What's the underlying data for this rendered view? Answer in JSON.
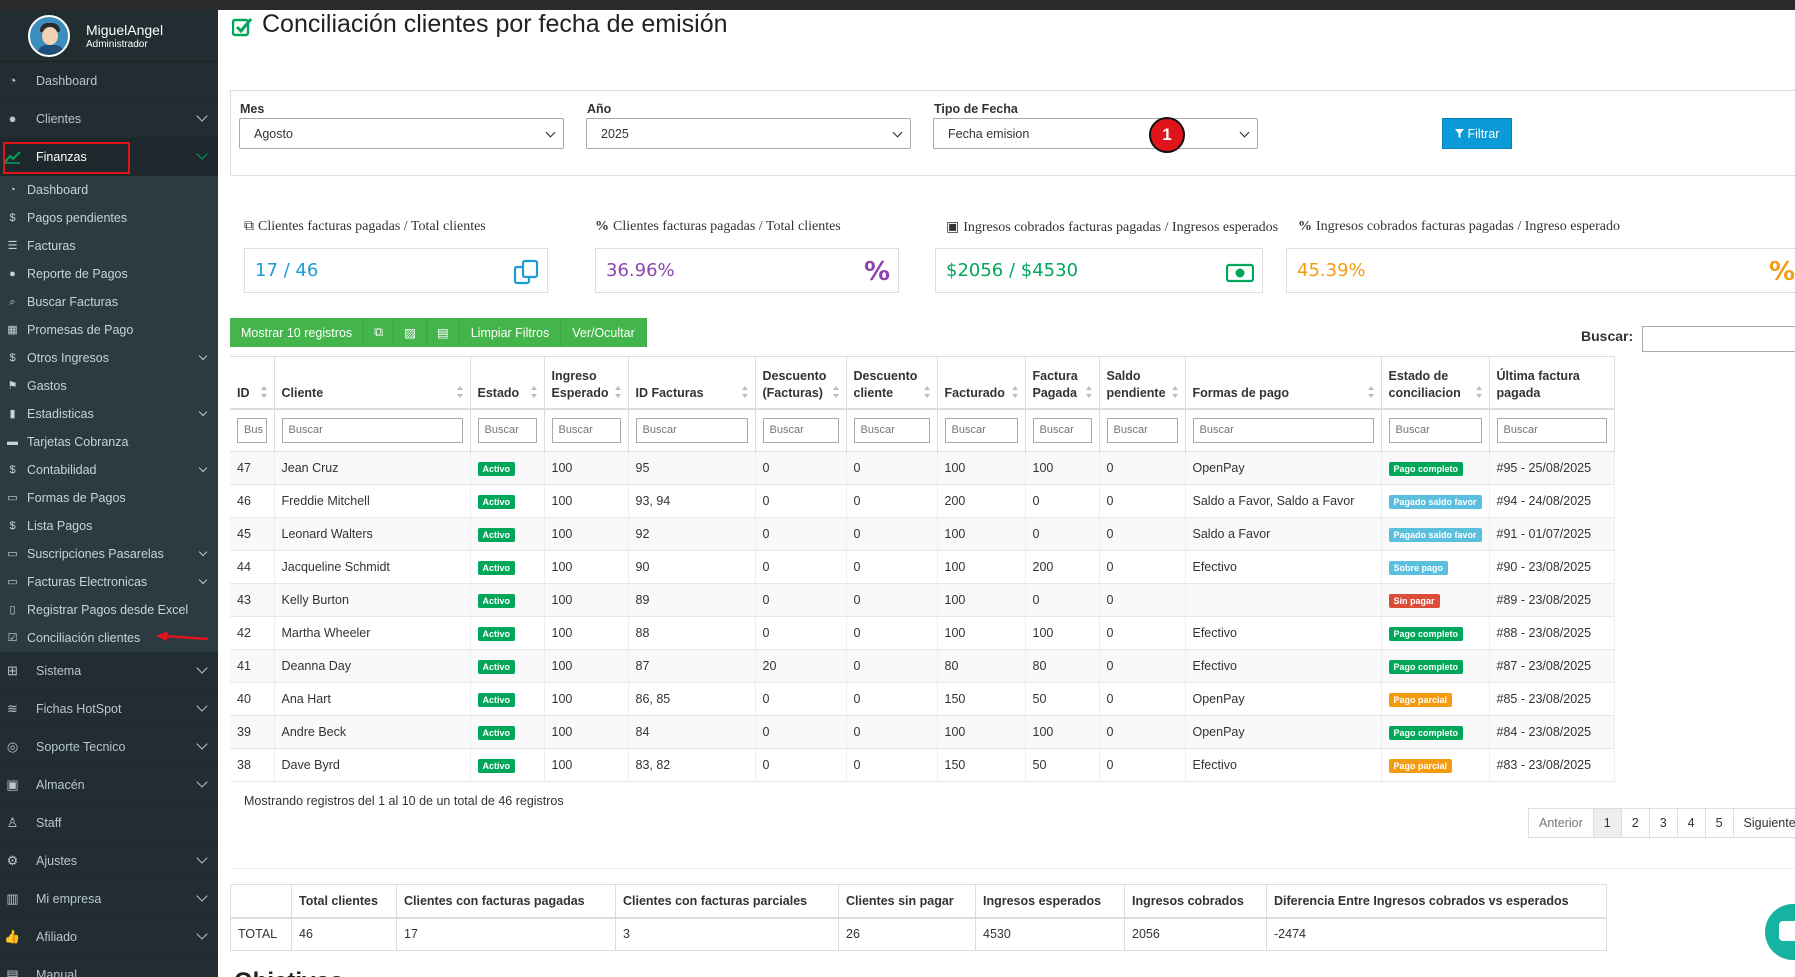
{
  "user": {
    "name": "MiguelAngel",
    "role": "Administrador"
  },
  "sidebar": {
    "top_items": [
      {
        "label": "Dashboard",
        "icon": "dashboard-icon",
        "chevron": false
      },
      {
        "label": "Clientes",
        "icon": "users-icon",
        "chevron": true
      },
      {
        "label": "Finanzas",
        "icon": "chart-line-icon",
        "chevron": true,
        "active": true
      }
    ],
    "finanzas_sub": [
      {
        "label": "Dashboard",
        "icon": "dashboard-icon",
        "chevron": false
      },
      {
        "label": "Pagos pendientes",
        "icon": "dollar-icon",
        "chevron": false
      },
      {
        "label": "Facturas",
        "icon": "list-icon",
        "chevron": false
      },
      {
        "label": "Reporte de Pagos",
        "icon": "info-circle-icon",
        "chevron": false
      },
      {
        "label": "Buscar Facturas",
        "icon": "search-icon",
        "chevron": false
      },
      {
        "label": "Promesas de Pago",
        "icon": "calendar-icon",
        "chevron": false
      },
      {
        "label": "Otros Ingresos",
        "icon": "dollar-icon",
        "chevron": true
      },
      {
        "label": "Gastos",
        "icon": "flag-icon",
        "chevron": false
      },
      {
        "label": "Estadisticas",
        "icon": "bar-chart-icon",
        "chevron": true
      },
      {
        "label": "Tarjetas Cobranza",
        "icon": "card-icon",
        "chevron": false
      },
      {
        "label": "Contabilidad",
        "icon": "dollar-icon",
        "chevron": true
      },
      {
        "label": "Formas de Pagos",
        "icon": "card-icon",
        "chevron": false
      },
      {
        "label": "Lista Pagos",
        "icon": "dollar-icon",
        "chevron": false
      },
      {
        "label": "Suscripciones Pasarelas",
        "icon": "card-icon",
        "chevron": true
      },
      {
        "label": "Facturas Electronicas",
        "icon": "card-icon",
        "chevron": true
      },
      {
        "label": "Registrar Pagos desde Excel",
        "icon": "file-icon",
        "chevron": false
      },
      {
        "label": "Conciliación clientes",
        "icon": "check-square-icon",
        "chevron": false
      }
    ],
    "bottom_items": [
      {
        "label": "Sistema",
        "icon": "sitemap-icon",
        "chevron": true
      },
      {
        "label": "Fichas HotSpot",
        "icon": "wifi-icon",
        "chevron": true
      },
      {
        "label": "Soporte Tecnico",
        "icon": "lifebuoy-icon",
        "chevron": true
      },
      {
        "label": "Almacén",
        "icon": "box-icon",
        "chevron": true
      },
      {
        "label": "Staff",
        "icon": "person-icon",
        "chevron": false
      },
      {
        "label": "Ajustes",
        "icon": "gear-icon",
        "chevron": true
      },
      {
        "label": "Mi empresa",
        "icon": "building-icon",
        "chevron": true
      },
      {
        "label": "Afiliado",
        "icon": "thumbs-up-icon",
        "chevron": true
      },
      {
        "label": "Manual",
        "icon": "book-icon",
        "chevron": false
      }
    ]
  },
  "page": {
    "title": "Conciliación clientes por fecha de emisión"
  },
  "filters": {
    "mes_label": "Mes",
    "mes_value": "Agosto",
    "anio_label": "Año",
    "anio_value": "2025",
    "tipo_label": "Tipo de Fecha",
    "tipo_value": "Fecha emision",
    "filtrar_label": "Filtrar",
    "annotation_number": "1"
  },
  "stats": [
    {
      "label": "Clientes facturas pagadas / Total clientes",
      "value": "17 / 46",
      "color": "#1e9bd7",
      "icon": "copy-icon"
    },
    {
      "label": "Clientes facturas pagadas / Total clientes",
      "value": "36.96%",
      "color": "#8e44ad",
      "icon": "percent-icon"
    },
    {
      "label": "Ingresos cobrados facturas pagadas / Ingresos esperados",
      "value": "$2056 / $4530",
      "color": "#00a65a",
      "icon": "money-icon"
    },
    {
      "label": "Ingresos cobrados facturas pagadas / Ingreso esperado",
      "value": "45.39%",
      "color": "#f39c12",
      "icon": "percent-icon"
    }
  ],
  "toolbar": {
    "show_label": "Mostrar 10 registros",
    "clear_label": "Limpiar Filtros",
    "toggle_label": "Ver/Ocultar",
    "search_label": "Buscar:"
  },
  "table": {
    "columns": [
      "ID",
      "Cliente",
      "Estado",
      "Ingreso Esperado",
      "ID Facturas",
      "Descuento (Facturas)",
      "Descuento cliente",
      "Facturado",
      "Factura Pagada",
      "Saldo pendiente",
      "Formas de pago",
      "Estado de conciliacion",
      "Última factura pagada"
    ],
    "filter_placeholder": "Buscar",
    "id_filter_placeholder": "Bus",
    "rows": [
      {
        "id": "47",
        "cliente": "Jean Cruz",
        "estado": "Activo",
        "esperado": "100",
        "facturas": "95",
        "desc_f": "0",
        "desc_c": "0",
        "facturado": "100",
        "pagada": "100",
        "saldo": "0",
        "formas": "OpenPay",
        "conc": "Pago completo",
        "conc_type": "completo",
        "ultima": "#95 - 25/08/2025"
      },
      {
        "id": "46",
        "cliente": "Freddie Mitchell",
        "estado": "Activo",
        "esperado": "100",
        "facturas": "93, 94",
        "desc_f": "0",
        "desc_c": "0",
        "facturado": "200",
        "pagada": "0",
        "saldo": "0",
        "formas": "Saldo a Favor, Saldo a Favor",
        "conc": "Pagado saldo favor",
        "conc_type": "favor",
        "ultima": "#94 - 24/08/2025"
      },
      {
        "id": "45",
        "cliente": "Leonard Walters",
        "estado": "Activo",
        "esperado": "100",
        "facturas": "92",
        "desc_f": "0",
        "desc_c": "0",
        "facturado": "100",
        "pagada": "0",
        "saldo": "0",
        "formas": "Saldo a Favor",
        "conc": "Pagado saldo favor",
        "conc_type": "favor",
        "ultima": "#91 - 01/07/2025"
      },
      {
        "id": "44",
        "cliente": "Jacqueline Schmidt",
        "estado": "Activo",
        "esperado": "100",
        "facturas": "90",
        "desc_f": "0",
        "desc_c": "0",
        "facturado": "100",
        "pagada": "200",
        "saldo": "0",
        "formas": "Efectivo",
        "conc": "Sobre pago",
        "conc_type": "sobre",
        "ultima": "#90 - 23/08/2025"
      },
      {
        "id": "43",
        "cliente": "Kelly Burton",
        "estado": "Activo",
        "esperado": "100",
        "facturas": "89",
        "desc_f": "0",
        "desc_c": "0",
        "facturado": "100",
        "pagada": "0",
        "saldo": "0",
        "formas": "",
        "conc": "Sin pagar",
        "conc_type": "sin",
        "ultima": "#89 - 23/08/2025"
      },
      {
        "id": "42",
        "cliente": "Martha Wheeler",
        "estado": "Activo",
        "esperado": "100",
        "facturas": "88",
        "desc_f": "0",
        "desc_c": "0",
        "facturado": "100",
        "pagada": "100",
        "saldo": "0",
        "formas": "Efectivo",
        "conc": "Pago completo",
        "conc_type": "completo",
        "ultima": "#88 - 23/08/2025"
      },
      {
        "id": "41",
        "cliente": "Deanna Day",
        "estado": "Activo",
        "esperado": "100",
        "facturas": "87",
        "desc_f": "20",
        "desc_c": "0",
        "facturado": "80",
        "pagada": "80",
        "saldo": "0",
        "formas": "Efectivo",
        "conc": "Pago completo",
        "conc_type": "completo",
        "ultima": "#87 - 23/08/2025"
      },
      {
        "id": "40",
        "cliente": "Ana Hart",
        "estado": "Activo",
        "esperado": "100",
        "facturas": "86, 85",
        "desc_f": "0",
        "desc_c": "0",
        "facturado": "150",
        "pagada": "50",
        "saldo": "0",
        "formas": "OpenPay",
        "conc": "Pago parcial",
        "conc_type": "parcial",
        "ultima": "#85 - 23/08/2025"
      },
      {
        "id": "39",
        "cliente": "Andre Beck",
        "estado": "Activo",
        "esperado": "100",
        "facturas": "84",
        "desc_f": "0",
        "desc_c": "0",
        "facturado": "100",
        "pagada": "100",
        "saldo": "0",
        "formas": "OpenPay",
        "conc": "Pago completo",
        "conc_type": "completo",
        "ultima": "#84 - 23/08/2025"
      },
      {
        "id": "38",
        "cliente": "Dave Byrd",
        "estado": "Activo",
        "esperado": "100",
        "facturas": "83, 82",
        "desc_f": "0",
        "desc_c": "0",
        "facturado": "150",
        "pagada": "50",
        "saldo": "0",
        "formas": "Efectivo",
        "conc": "Pago parcial",
        "conc_type": "parcial",
        "ultima": "#83 - 23/08/2025"
      }
    ]
  },
  "info": "Mostrando registros del 1 al 10 de un total de 46 registros",
  "pagination": {
    "prev": "Anterior",
    "pages": [
      "1",
      "2",
      "3",
      "4",
      "5"
    ],
    "next": "Siguiente",
    "current": "1"
  },
  "summary": {
    "columns": [
      "",
      "Total clientes",
      "Clientes con facturas pagadas",
      "Clientes con facturas parciales",
      "Clientes sin pagar",
      "Ingresos esperados",
      "Ingresos cobrados",
      "Diferencia Entre Ingresos cobrados vs esperados"
    ],
    "row": [
      "TOTAL",
      "46",
      "17",
      "3",
      "26",
      "4530",
      "2056",
      "-2474"
    ]
  },
  "bottom_heading": "Objetivos"
}
